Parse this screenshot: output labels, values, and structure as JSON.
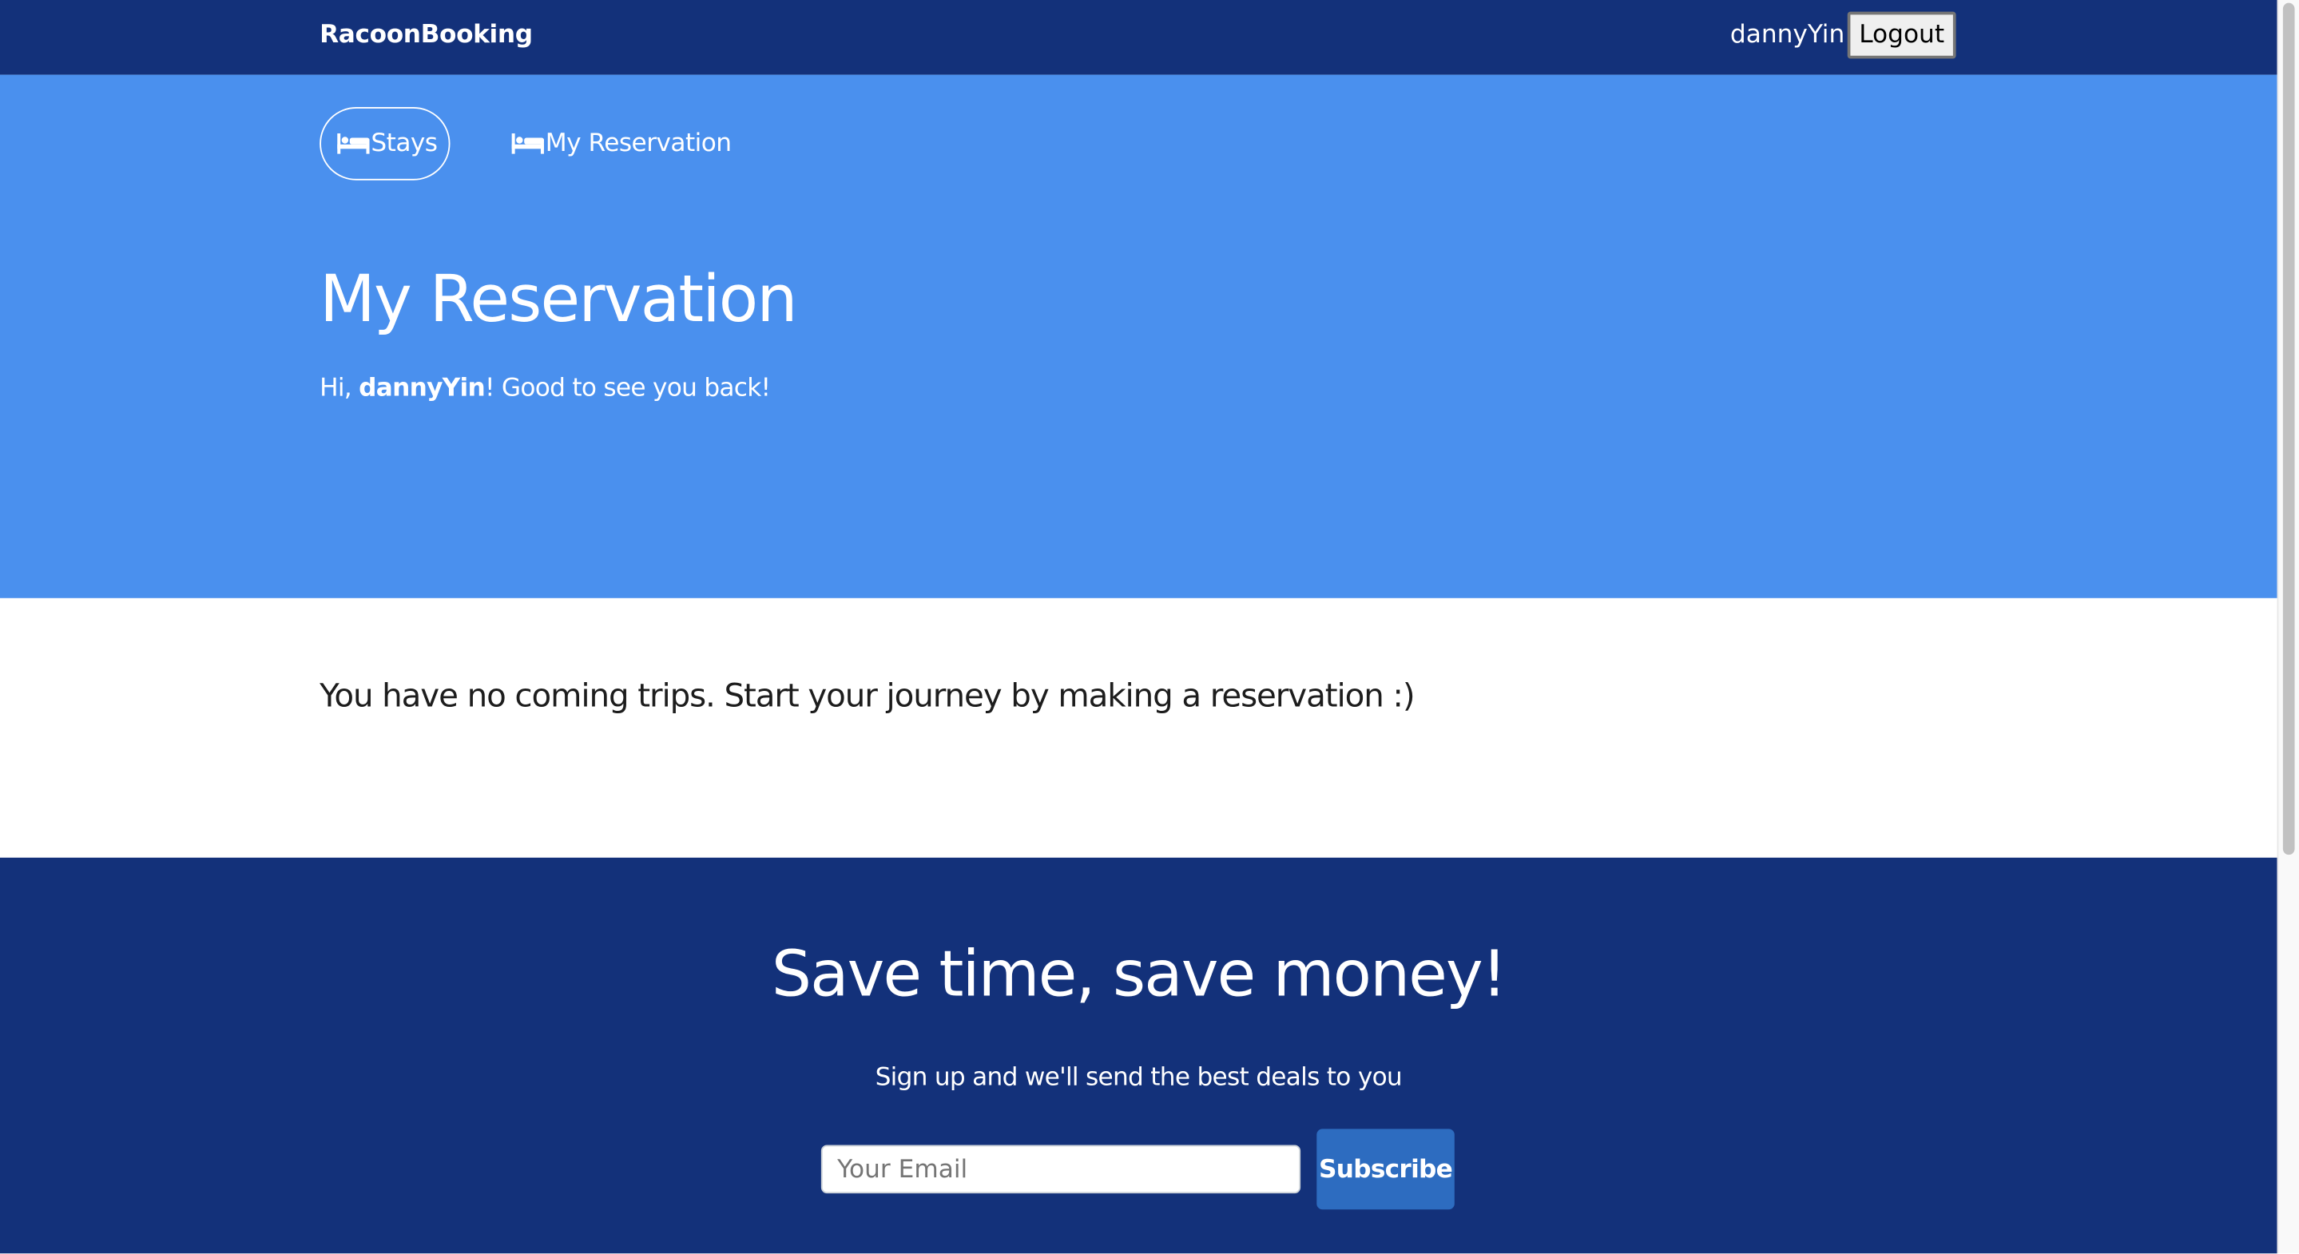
{
  "navbar": {
    "brand": "RacoonBooking",
    "username": "dannyYin",
    "logout_label": "Logout"
  },
  "hero": {
    "tabs": [
      {
        "label": "Stays",
        "icon": "bed-icon",
        "active": true
      },
      {
        "label": "My Reservation",
        "icon": "bed-icon",
        "active": false
      }
    ],
    "title": "My Reservation",
    "greeting_prefix": "Hi, ",
    "greeting_name": "dannyYin",
    "greeting_suffix": "! Good to see you back!"
  },
  "main": {
    "empty_message": "You have no coming trips. Start your journey by making a reservation :)"
  },
  "newsletter": {
    "title": "Save time, save money!",
    "subtitle": "Sign up and we'll send the best deals to you",
    "email_placeholder": "Your Email",
    "email_value": "",
    "subscribe_label": "Subscribe"
  },
  "colors": {
    "navbar_bg": "#13317a",
    "hero_bg": "#4a90ee",
    "subscribe_bg": "#2d6cc0",
    "text_dark": "#1d1d1d"
  }
}
